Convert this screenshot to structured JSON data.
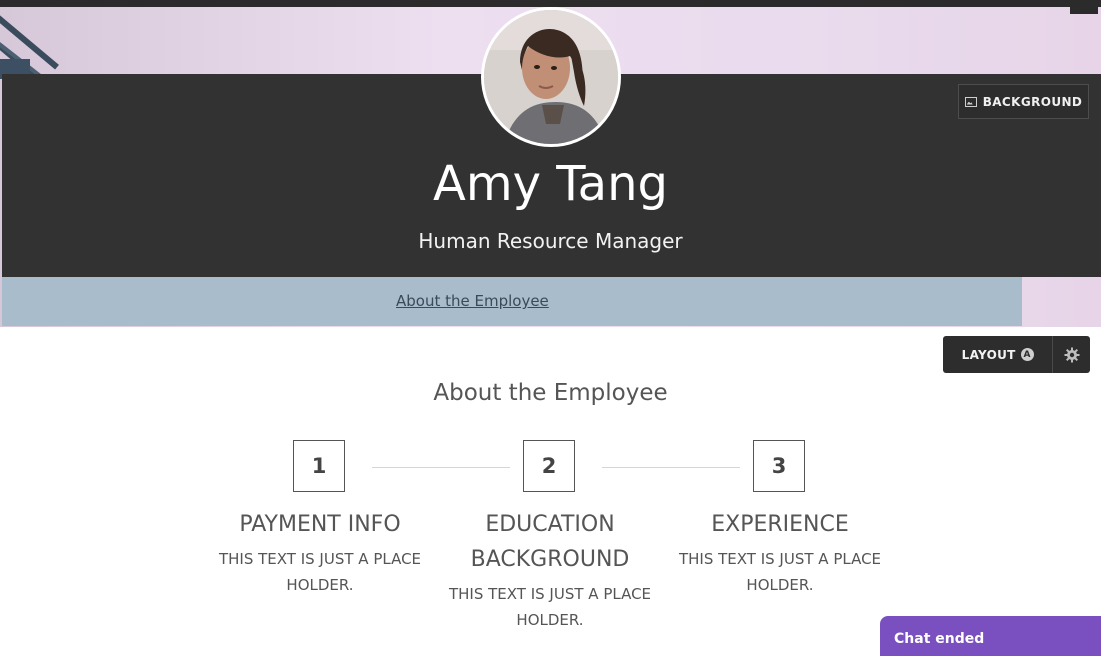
{
  "header": {
    "name": "Amy Tang",
    "title": "Human Resource Manager",
    "background_button_label": "BACKGROUND",
    "background_button_icon": "image-icon"
  },
  "nav": {
    "link_label": "About the Employee"
  },
  "layout_controls": {
    "layout_label": "LAYOUT",
    "badge": "A",
    "gear_icon": "gear-icon"
  },
  "section": {
    "title": "About the Employee",
    "steps": [
      {
        "number": "1",
        "title": "PAYMENT INFO",
        "description": "THIS TEXT IS JUST A PLACE HOLDER."
      },
      {
        "number": "2",
        "title": "EDUCATION BACKGROUND",
        "description": "THIS TEXT IS JUST A PLACE HOLDER."
      },
      {
        "number": "3",
        "title": "EXPERIENCE",
        "description": "THIS TEXT IS JUST A PLACE HOLDER."
      }
    ]
  },
  "chat": {
    "status": "Chat ended"
  },
  "colors": {
    "header_band": "#323232",
    "nav_bar": "#a8bccb",
    "chat_accent": "#7a4fc0"
  }
}
